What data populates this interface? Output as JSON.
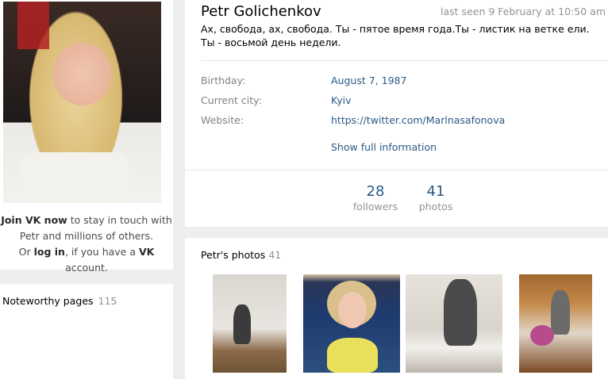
{
  "left": {
    "join_bold": "Join VK now",
    "join_rest": " to stay in touch with Petr and millions of others.",
    "join_or": "Or ",
    "login": "log in",
    "join_mid": ", if you have a ",
    "vk": "VK",
    "join_end": " account.",
    "noteworthy_label": "Noteworthy pages",
    "noteworthy_count": "115"
  },
  "profile": {
    "name": "Petr Golichenkov",
    "last_seen": "last seen 9 February at 10:50 am",
    "status": "Ах, свобода, ах, свобода. Ты - пятое время года.Ты - листик на ветке ели. Ты - восьмой день недели.",
    "info": [
      {
        "label": "Birthday:",
        "value": "August 7, 1987"
      },
      {
        "label": "Current city:",
        "value": "Kyiv"
      },
      {
        "label": "Website:",
        "value": "https://twitter.com/Marlnasafonova"
      }
    ],
    "show_full": "Show full information",
    "followers_count": "28",
    "followers_label": "followers",
    "photos_count": "41",
    "photos_label": "photos"
  },
  "photos": {
    "title": "Petr's photos",
    "count": "41"
  },
  "colors": {
    "link": "#2a5885",
    "muted": "#939393",
    "background": "#edeef0"
  }
}
